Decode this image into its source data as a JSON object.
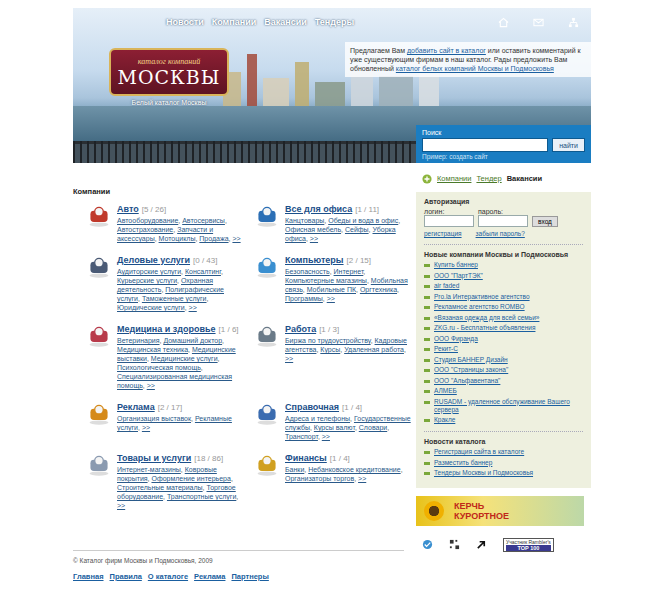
{
  "header": {
    "nav": [
      {
        "label": "Новости"
      },
      {
        "label": "Компании"
      },
      {
        "label": "Вакансии"
      },
      {
        "label": "Тендеры"
      }
    ],
    "logo": {
      "top": "каталог компаний",
      "main": "МОСКВЫ",
      "slogan": "Белый каталог Москвы"
    },
    "intro": [
      {
        "text": "Предлагаем Вам ",
        "link": false
      },
      {
        "text": "добавить сайт в каталог",
        "link": true
      },
      {
        "text": " или оставить комментарий к уже существующим фирмам в наш каталог. Рады предложить Вам обновленный ",
        "link": false
      },
      {
        "text": "каталог белых компаний Москвы и Подмосковья",
        "link": true
      }
    ],
    "search": {
      "label": "Поиск",
      "value": "",
      "button": "найти",
      "example": "Пример: создать сайт"
    }
  },
  "catalog": {
    "title": "Компании",
    "separator": ", ",
    "more": ">>",
    "categories": [
      {
        "name": "Авто",
        "count": "[5 / 26]",
        "subs": [
          "Автооборудование",
          "Автосервисы",
          "Автострахование",
          "Запчасти и аксессуары",
          "Мотоциклы",
          "Продажа"
        ]
      },
      {
        "name": "Все для офиса",
        "count": "[1 / 11]",
        "subs": [
          "Канцтовары",
          "Обеды и вода в офис",
          "Офисная мебель",
          "Сейфы",
          "Уборка офиса"
        ]
      },
      {
        "name": "Деловые услуги",
        "count": "[0 / 43]",
        "subs": [
          "Аудиторские услуги",
          "Консалтинг",
          "Курьерские услуги",
          "Охранная деятельность",
          "Полиграфические услуги",
          "Таможенные услуги",
          "Юридические услуги"
        ]
      },
      {
        "name": "Компьютеры",
        "count": "[2 / 15]",
        "subs": [
          "Безопасность",
          "Интернет",
          "Компьютерные магазины",
          "Мобильная связь",
          "Мобильные ПК",
          "Оргтехника",
          "Программы"
        ]
      },
      {
        "name": "Медицина и здоровье",
        "count": "[1 / 6]",
        "subs": [
          "Ветеринария",
          "Домашний доктор",
          "Медицинская техника",
          "Медицинские выставки",
          "Медицинские услуги",
          "Психологическая помощь",
          "Специализированная медицинская помощь"
        ]
      },
      {
        "name": "Работа",
        "count": "[1 / 3]",
        "subs": [
          "Биржа по трудоустройству",
          "Кадровые агентства",
          "Курсы",
          "Удаленная работа"
        ]
      },
      {
        "name": "Реклама",
        "count": "[2 / 17]",
        "subs": [
          "Организация выставок",
          "Рекламные услуги"
        ]
      },
      {
        "name": "Справочная",
        "count": "[1 / 4]",
        "subs": [
          "Адреса и телефоны",
          "Государственные службы",
          "Курсы валют",
          "Словари",
          "Транспорт"
        ]
      },
      {
        "name": "Товары и услуги",
        "count": "[18 / 86]",
        "subs": [
          "Интернет-магазины",
          "Ковровые покрытия",
          "Оформление интерьера",
          "Строительные материалы",
          "Торговое оборудование",
          "Транспортные услуги"
        ]
      },
      {
        "name": "Финансы",
        "count": "[1 / 4]",
        "subs": [
          "Банки",
          "Небанковское кредитование",
          "Организаторы торгов"
        ]
      }
    ]
  },
  "footer": {
    "copyright": "© Каталог фирм Москвы и Подмосковья, 2009",
    "links": [
      "Главная",
      "Правила",
      "О каталоге",
      "Реклама",
      "Партнеры"
    ]
  },
  "sidebar": {
    "tabs": [
      {
        "label": "Компании",
        "selected": false
      },
      {
        "label": "Тендер",
        "selected": false
      },
      {
        "label": "Вакансии",
        "selected": true
      }
    ],
    "auth": {
      "title": "Авторизация",
      "login_label": "логин:",
      "password_label": "пароль:",
      "login_value": "",
      "password_value": "",
      "button": "вход",
      "register": "регистрация",
      "forgot": "забыли пароль?"
    },
    "new_companies": {
      "title": "Новые компании Москвы и Подмосковья",
      "items": [
        "Купить баннер",
        "ООО \"ПартТЭК\"",
        "air faded",
        "Pro.la Интерактивное агентство",
        "Рекламное агентство ROMBO",
        "«Вязаная одежда для всей семьи»",
        "ZKG.ru - Бесплатные объявления",
        "ООО Фиранда",
        "Рекит-С",
        "Студия БАННЕР Дизайн",
        "ООО \"Страницы закона\"",
        "ООО \"Альфавентана\"",
        "АЛМЕБ",
        "RUSADM - удаленное обслуживание Вашего сервера",
        "Кракле"
      ]
    },
    "news": {
      "title": "Новости каталога",
      "items": [
        "Регистрация сайта в каталоге",
        "Разместить баннер",
        "Тендеры Москвы и Подмосковья"
      ]
    },
    "banner": {
      "line1": "КЕРЧЬ",
      "line2": "КУРОРТНОЕ"
    },
    "counter": {
      "top": "Участник",
      "name": "Rambler's",
      "rank": "TOP 100"
    }
  }
}
